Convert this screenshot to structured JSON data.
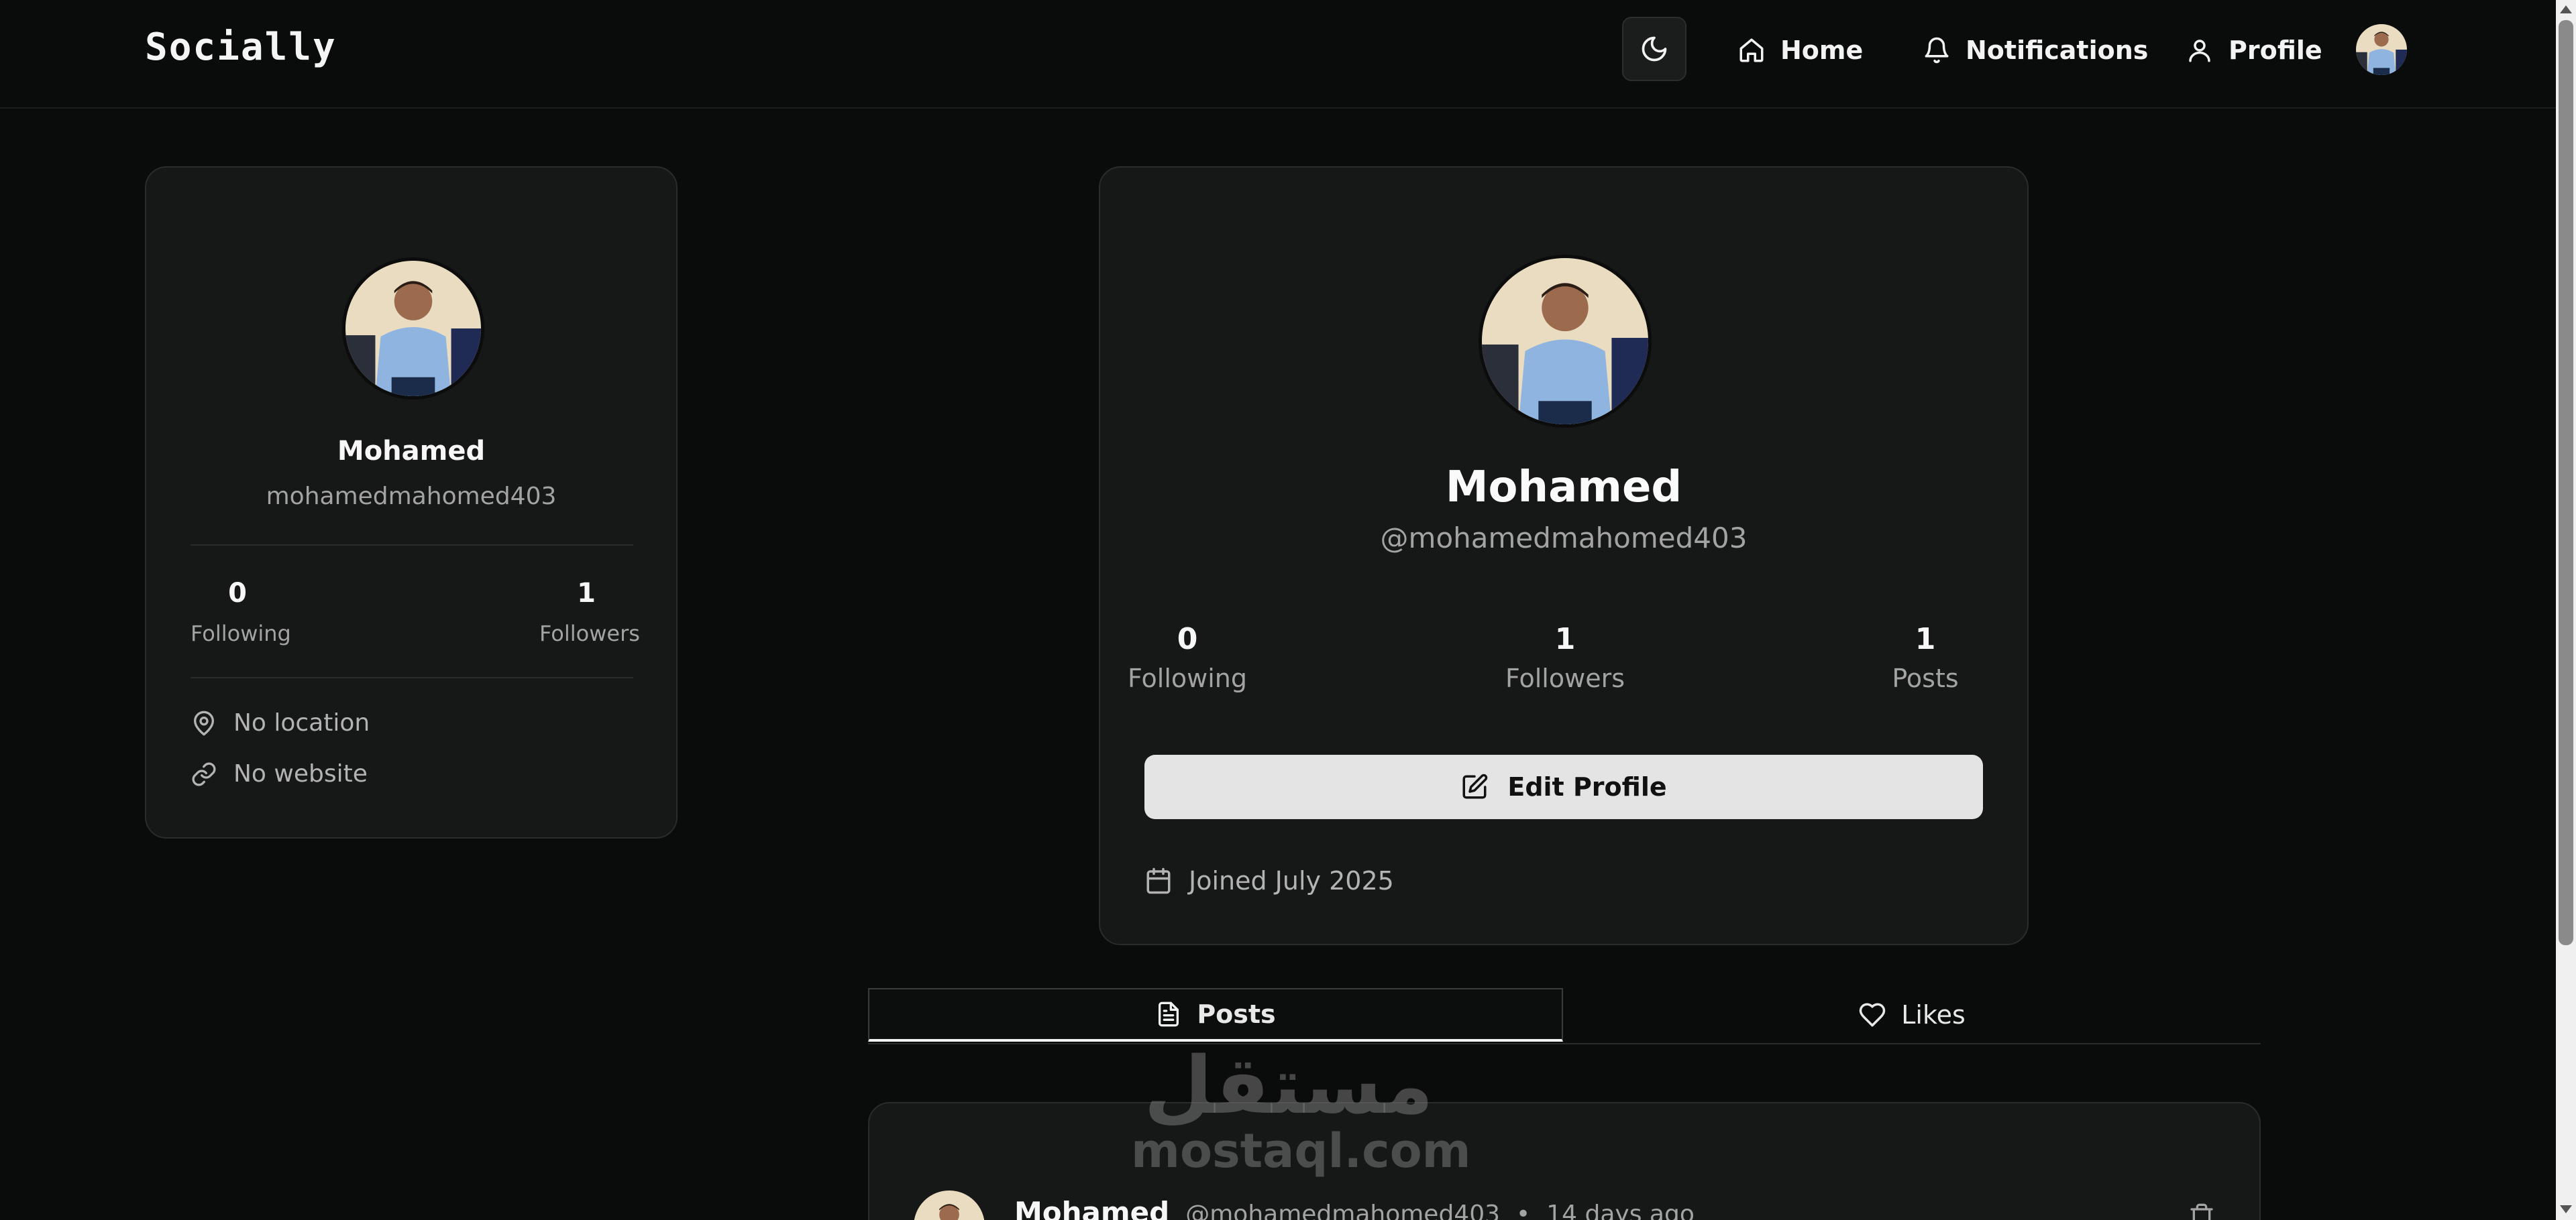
{
  "brand": "Socially",
  "nav": {
    "home_label": "Home",
    "notifications_label": "Notifications",
    "profile_label": "Profile",
    "theme_icon": "moon-icon"
  },
  "sidebar": {
    "name": "Mohamed",
    "username": "mohamedmahomed403",
    "following_count": "0",
    "following_label": "Following",
    "followers_count": "1",
    "followers_label": "Followers",
    "location": "No location",
    "website": "No website"
  },
  "profile": {
    "name": "Mohamed",
    "handle": "@mohamedmahomed403",
    "stats": [
      {
        "value": "0",
        "label": "Following"
      },
      {
        "value": "1",
        "label": "Followers"
      },
      {
        "value": "1",
        "label": "Posts"
      }
    ],
    "edit_button_label": "Edit Profile",
    "joined": "Joined July 2025"
  },
  "tabs": {
    "posts_label": "Posts",
    "likes_label": "Likes"
  },
  "post": {
    "author": "Mohamed",
    "handle": "@mohamedmahomed403",
    "separator": "•",
    "time": "14 days ago"
  },
  "watermark": {
    "arabic": "مستقل",
    "latin": "mostaql.com"
  },
  "colors": {
    "background": "#0a0b0b",
    "card": "#161717",
    "muted_text": "#a3a3a3",
    "button_bg": "#e4e4e4"
  }
}
